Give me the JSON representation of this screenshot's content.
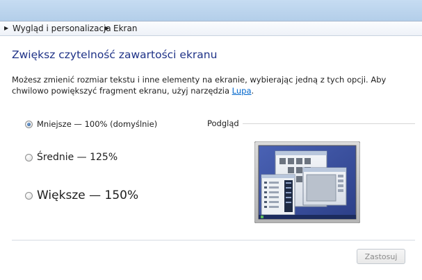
{
  "breadcrumb": {
    "items": [
      "Wygląd i personalizacja",
      "Ekran"
    ]
  },
  "main": {
    "heading": "Zwiększ czytelność zawartości ekranu",
    "description": "Możesz zmienić rozmiar tekstu i inne elementy na ekranie, wybierając jedną z tych opcji. Aby chwilowo powiększyć fragment ekranu, użyj narzędzia",
    "link_text": "Lupa",
    "description_end": "."
  },
  "options": [
    {
      "label": "Mniejsze — 100% (domyślnie)",
      "checked": true
    },
    {
      "label": "Średnie — 125%",
      "checked": false
    },
    {
      "label": "Większe — 150%",
      "checked": false
    }
  ],
  "preview": {
    "label": "Podgląd"
  },
  "footer": {
    "apply_label": "Zastosuj",
    "apply_enabled": false
  },
  "colors": {
    "heading": "#1e3287",
    "link": "#0066cc",
    "desktop": "#3a4f9e"
  }
}
